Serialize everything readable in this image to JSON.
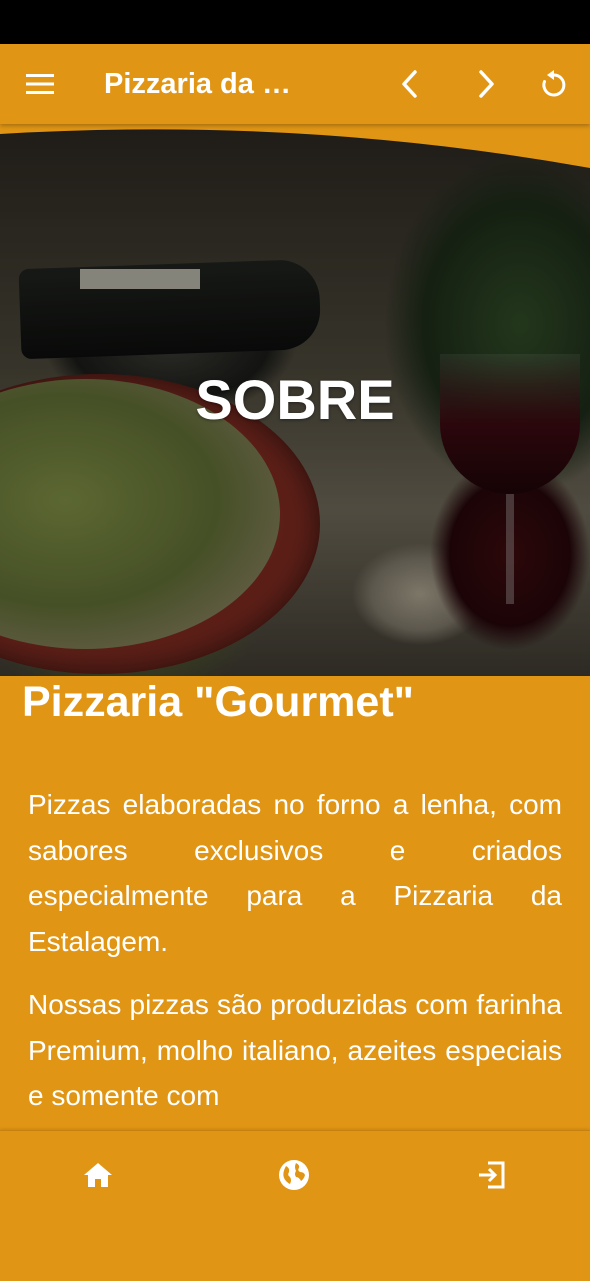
{
  "app_bar": {
    "title": "Pizzaria da Estalagem",
    "menu_icon": "menu-icon",
    "back_icon": "chevron-left-icon",
    "forward_icon": "chevron-right-icon",
    "reload_icon": "refresh-icon"
  },
  "hero": {
    "title": "SOBRE"
  },
  "content": {
    "heading": "Pizzaria \"Gourmet\"",
    "paragraphs": [
      "Pizzas elaboradas no forno a lenha, com sabores exclusivos e criados especialmente para a Pizzaria da Estalagem.",
      "Nossas pizzas são produzidas com farinha Premium, molho italiano, azeites especiais e somente com"
    ]
  },
  "bottom_nav": {
    "items": [
      {
        "icon": "home-icon"
      },
      {
        "icon": "globe-icon"
      },
      {
        "icon": "logout-icon"
      }
    ]
  },
  "colors": {
    "primary": "#e19514",
    "on_primary": "#ffffff",
    "status_bar": "#000000"
  }
}
